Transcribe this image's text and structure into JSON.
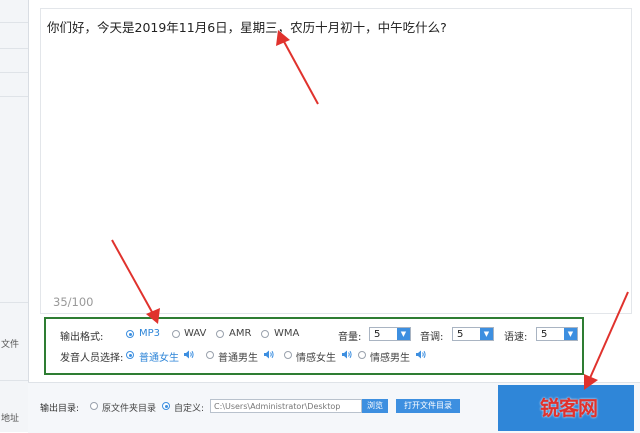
{
  "left_sidebar": {
    "item_1": "文件",
    "item_2": "地址"
  },
  "editor": {
    "text": "你们好，今天是2019年11月6日，星期三，农历十月初十，中午吃什么?",
    "char_count": "35/100"
  },
  "settings": {
    "output_format_label": "输出格式:",
    "formats": [
      "MP3",
      "WAV",
      "AMR",
      "WMA"
    ],
    "selected_format": "MP3",
    "volume_label": "音量:",
    "volume_value": "5",
    "pitch_label": "音调:",
    "pitch_value": "5",
    "speed_label": "语速:",
    "speed_value": "5",
    "voice_label": "发音人员选择:",
    "voices": [
      "普通女生",
      "普通男生",
      "情感女生",
      "情感男生"
    ],
    "selected_voice": "普通女生"
  },
  "output": {
    "dir_label": "输出目录:",
    "option_original": "原文件夹目录",
    "option_custom": "自定义:",
    "path_value": "C:\\Users\\Administrator\\Desktop",
    "browse_label": "浏览",
    "open_folder_label": "打开文件目录"
  },
  "watermark": "锐客网",
  "colors": {
    "accent": "#3d8fe0",
    "highlight_border": "#2e7d32",
    "annotation_arrow": "#e0322d"
  }
}
